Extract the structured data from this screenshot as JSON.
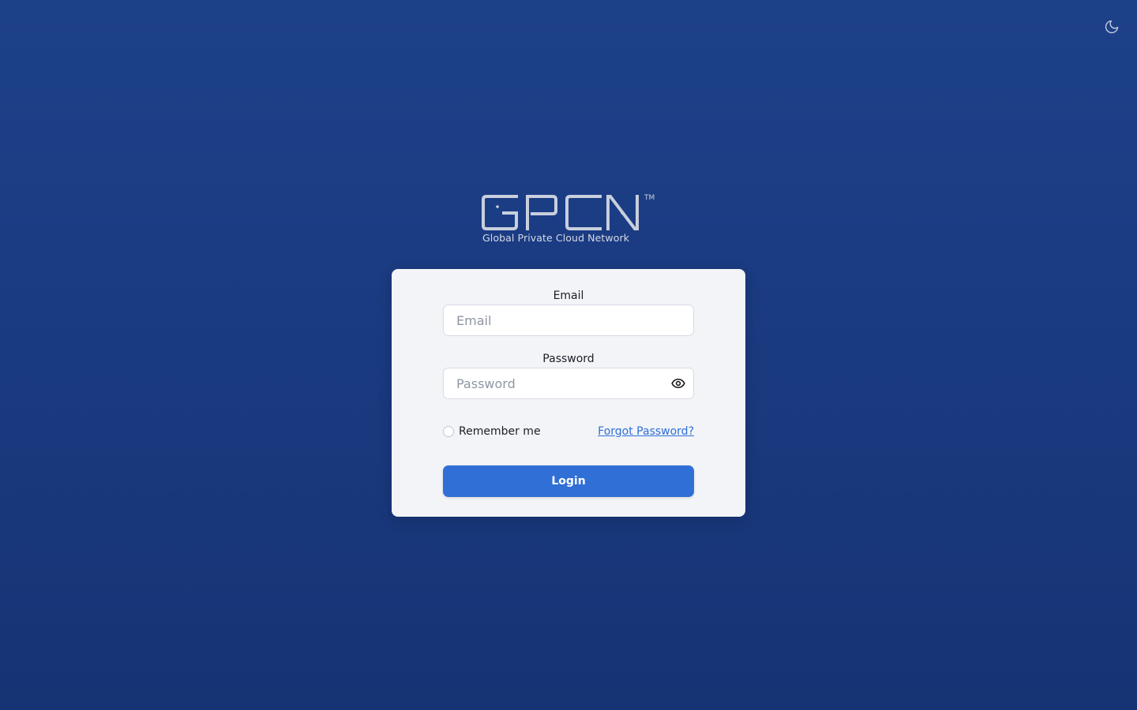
{
  "header": {
    "theme_toggle_icon": "moon-icon"
  },
  "logo": {
    "wordmark": "GPCN",
    "trademark": "TM",
    "tagline": "Global Private Cloud Network"
  },
  "form": {
    "email": {
      "label": "Email",
      "placeholder": "Email",
      "value": ""
    },
    "password": {
      "label": "Password",
      "placeholder": "Password",
      "value": "",
      "toggle_icon": "eye-icon"
    },
    "remember_me": {
      "label": "Remember me",
      "checked": false
    },
    "forgot_password_label": "Forgot Password?",
    "login_label": "Login"
  },
  "colors": {
    "background_top": "#1d4189",
    "background_bottom": "#163374",
    "card": "#f2f4f8",
    "primary": "#2f6fd6",
    "link": "#2f6fd6"
  }
}
